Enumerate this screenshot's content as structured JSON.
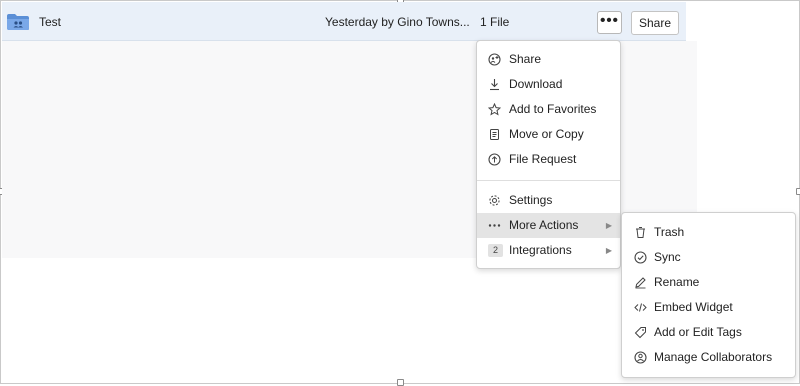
{
  "file_row": {
    "name": "Test",
    "modified": "Yesterday by Gino Towns...",
    "item_count": "1 File",
    "more_label": "•••",
    "share_label": "Share"
  },
  "menu": {
    "items": [
      {
        "label": "Share",
        "icon": "share-icon"
      },
      {
        "label": "Download",
        "icon": "download-icon"
      },
      {
        "label": "Add to Favorites",
        "icon": "star-icon"
      },
      {
        "label": "Move or Copy",
        "icon": "copy-icon"
      },
      {
        "label": "File Request",
        "icon": "upload-cloud-icon"
      },
      {
        "label": "Settings",
        "icon": "gear-icon"
      },
      {
        "label": "More Actions",
        "icon": "ellipsis-icon"
      },
      {
        "label": "Integrations",
        "icon": "integrations-badge",
        "badge": "2"
      }
    ]
  },
  "submenu": {
    "items": [
      {
        "label": "Trash",
        "icon": "trash-icon"
      },
      {
        "label": "Sync",
        "icon": "sync-check-icon"
      },
      {
        "label": "Rename",
        "icon": "pencil-icon"
      },
      {
        "label": "Embed Widget",
        "icon": "code-icon"
      },
      {
        "label": "Add or Edit Tags",
        "icon": "tag-icon"
      },
      {
        "label": "Manage Collaborators",
        "icon": "collaborators-icon"
      }
    ]
  },
  "colors": {
    "row_highlight": "#e9f0f9",
    "folder": "#5b8fd6",
    "menu_active": "#e4e4e4"
  }
}
